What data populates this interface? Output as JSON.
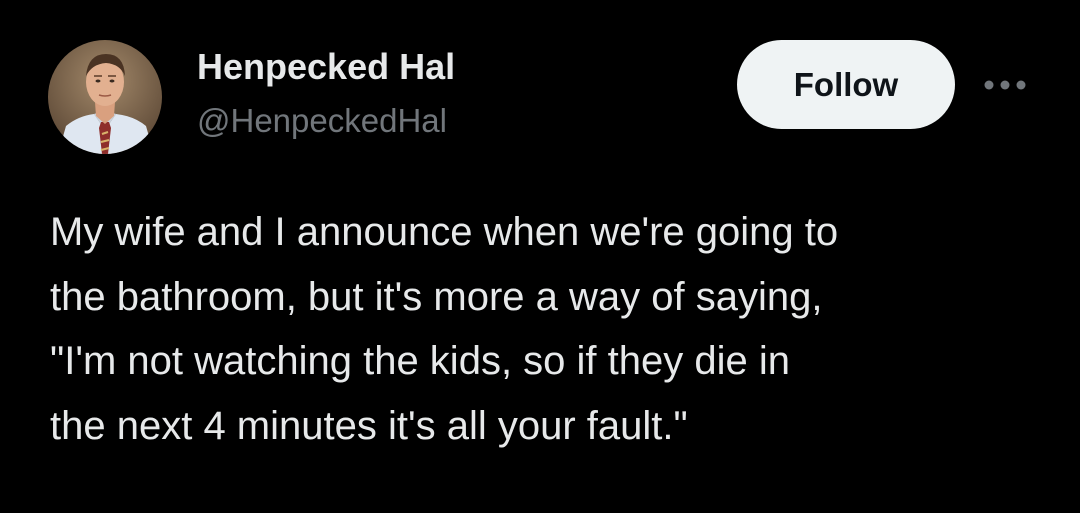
{
  "user": {
    "display_name": "Henpecked Hal",
    "handle": "@HenpeckedHal"
  },
  "actions": {
    "follow_label": "Follow",
    "more_icon": "more-horizontal-icon"
  },
  "tweet": {
    "lines": [
      "My wife and I announce when we're going to",
      "the bathroom, but it's more a way of saying,",
      "\"I'm not watching the kids, so if they die in",
      "the next 4 minutes it's all your fault.\""
    ]
  },
  "colors": {
    "background": "#000000",
    "primary_text": "#e7e9ea",
    "secondary_text": "#71767b",
    "follow_bg": "#eff3f4",
    "follow_text": "#0f1419"
  }
}
